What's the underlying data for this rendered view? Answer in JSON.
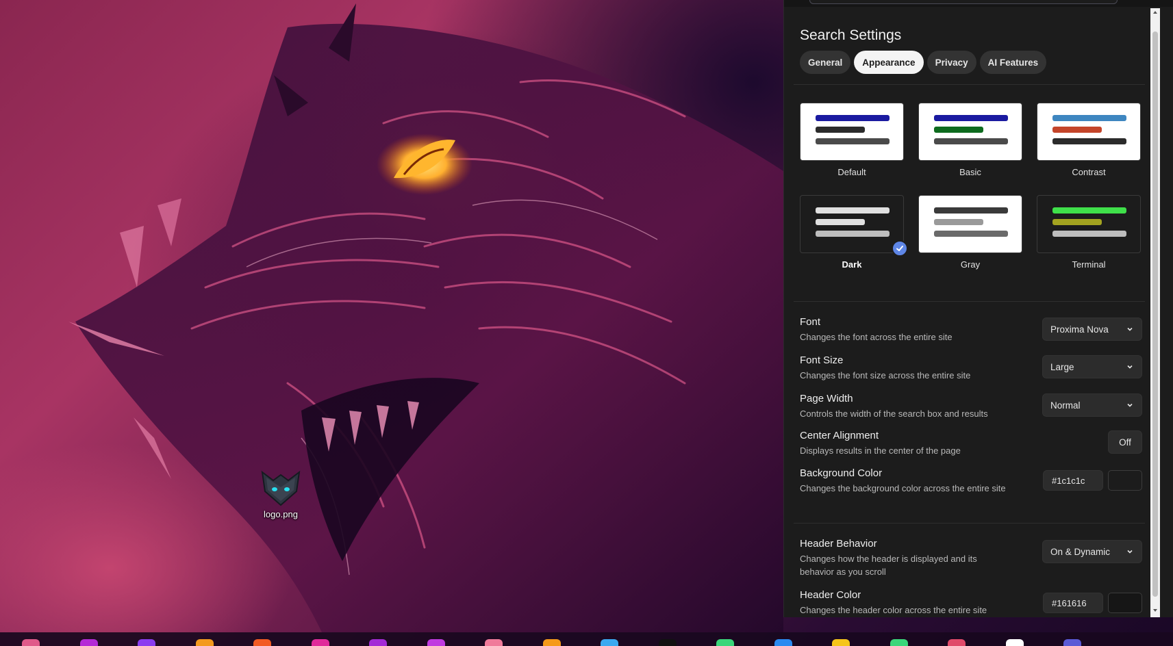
{
  "desktop": {
    "icon_file": "logo.png"
  },
  "panel": {
    "title": "Search Settings",
    "tabs": [
      {
        "label": "General",
        "active": false
      },
      {
        "label": "Appearance",
        "active": true
      },
      {
        "label": "Privacy",
        "active": false
      },
      {
        "label": "AI Features",
        "active": false
      }
    ],
    "themes": [
      {
        "name": "Default",
        "selected": false,
        "card_bg": "#ffffff",
        "bars": [
          "#1a1aa0",
          "#2b2b2b",
          "#4a4a4a"
        ]
      },
      {
        "name": "Basic",
        "selected": false,
        "card_bg": "#ffffff",
        "bars": [
          "#1a1aa0",
          "#0e6b1e",
          "#4a4a4a"
        ]
      },
      {
        "name": "Contrast",
        "selected": false,
        "card_bg": "#ffffff",
        "bars": [
          "#3e86c0",
          "#c4452a",
          "#2b2b2b"
        ]
      },
      {
        "name": "Dark",
        "selected": true,
        "card_bg": "#1c1c1c",
        "bars": [
          "#e0e0e0",
          "#e0e0e0",
          "#bdbdbd"
        ]
      },
      {
        "name": "Gray",
        "selected": false,
        "card_bg": "#ffffff",
        "bars": [
          "#3a3a3a",
          "#9a9a9a",
          "#6a6a6a"
        ]
      },
      {
        "name": "Terminal",
        "selected": false,
        "card_bg": "#1c1c1c",
        "bars": [
          "#3fe04a",
          "#a3a320",
          "#bdbdbd"
        ]
      }
    ],
    "settings": {
      "font": {
        "title": "Font",
        "desc": "Changes the font across the entire site",
        "value": "Proxima Nova"
      },
      "font_size": {
        "title": "Font Size",
        "desc": "Changes the font size across the entire site",
        "value": "Large"
      },
      "page_width": {
        "title": "Page Width",
        "desc": "Controls the width of the search box and results",
        "value": "Normal"
      },
      "center_alignment": {
        "title": "Center Alignment",
        "desc": "Displays results in the center of the page",
        "value": "Off"
      },
      "background_color": {
        "title": "Background Color",
        "desc": "Changes the background color across the entire site",
        "value": "#1c1c1c"
      },
      "header_behavior": {
        "title": "Header Behavior",
        "desc": "Changes how the header is displayed and its behavior as you scroll",
        "value": "On & Dynamic"
      },
      "header_color": {
        "title": "Header Color",
        "desc": "Changes the header color across the entire site",
        "value": "#161616"
      }
    }
  },
  "dock": {
    "icon_colors": [
      "#e05a8a",
      "#b42ad6",
      "#8a3cf0",
      "#f39a1e",
      "#f25a22",
      "#e02a9a",
      "#a32ad6",
      "#c03ae0",
      "#f07a9a",
      "#f59a1a",
      "#3aa9f0",
      "#111111",
      "#3ad67a",
      "#2a8af0",
      "#f5c51a",
      "#3ad67a",
      "#e04a6a",
      "#ffffff",
      "#5a5ad6"
    ]
  }
}
